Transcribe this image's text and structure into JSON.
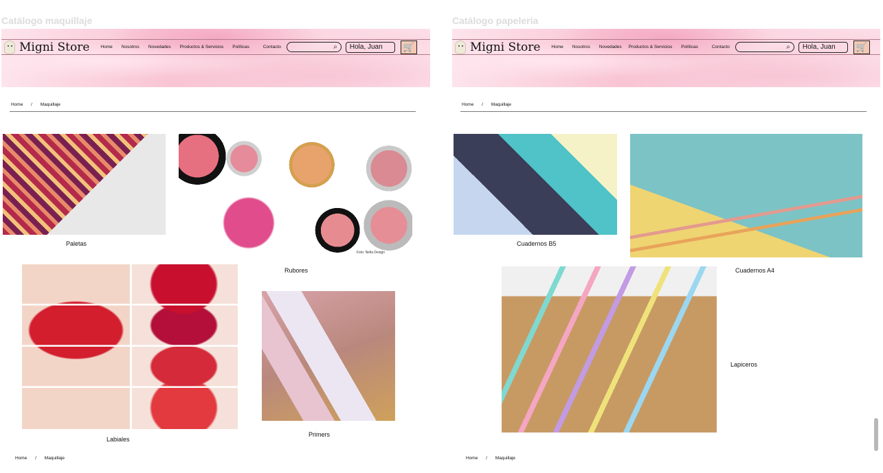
{
  "left": {
    "catalog_title": "Catálogo maquillaje",
    "brand": "Migni Store",
    "nav": [
      "Home",
      "Nosotros",
      "Novedades",
      "Productos & Servicios",
      "Políticas",
      "Contacto"
    ],
    "search_icon": "⌕",
    "greeting": "Hola, Juan",
    "cart_icon": "🛒",
    "breadcrumb": [
      "Home",
      "/",
      "Maquillaje"
    ],
    "categories": [
      {
        "label": "Paletas"
      },
      {
        "label": "Rubores",
        "credit": "Foto: Nella Design"
      },
      {
        "label": "Labiales"
      },
      {
        "label": "Primers"
      }
    ],
    "footer_breadcrumb": [
      "Home",
      "/",
      "Maquillaje"
    ]
  },
  "right": {
    "catalog_title": "Catálogo papelería",
    "brand": "Migni Store",
    "nav": [
      "Home",
      "Nosotros",
      "Novedades",
      "Productos & Servicios",
      "Políticas",
      "Contacto"
    ],
    "search_icon": "⌕",
    "greeting": "Hola, Juan",
    "cart_icon": "🛒",
    "breadcrumb": [
      "Home",
      "/",
      "Maquillaje"
    ],
    "categories": [
      {
        "label": "Cuadernos B5"
      },
      {
        "label": "Cuadernos A4"
      },
      {
        "label": "Lapiceros"
      }
    ],
    "footer_breadcrumb": [
      "Home",
      "/",
      "Maquillaje"
    ]
  }
}
